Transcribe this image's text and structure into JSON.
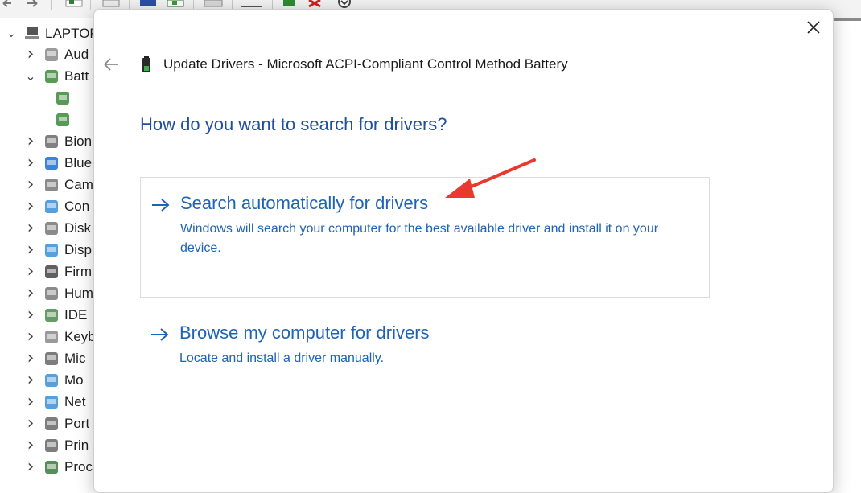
{
  "device_tree": {
    "root_label": "LAPTOP",
    "items": [
      {
        "label": "Aud",
        "icon": "speaker-icon",
        "expanded": false
      },
      {
        "label": "Batt",
        "icon": "battery-icon",
        "expanded": true
      },
      {
        "label": "",
        "icon": "battery-device-icon",
        "child": true
      },
      {
        "label": "",
        "icon": "battery-device-icon",
        "child": true
      },
      {
        "label": "Bion",
        "icon": "fingerprint-icon",
        "expanded": false
      },
      {
        "label": "Blue",
        "icon": "bluetooth-icon",
        "expanded": false
      },
      {
        "label": "Cam",
        "icon": "camera-icon",
        "expanded": false
      },
      {
        "label": "Con",
        "icon": "monitor-icon",
        "expanded": false
      },
      {
        "label": "Disk",
        "icon": "disk-drive-icon",
        "expanded": false
      },
      {
        "label": "Disp",
        "icon": "display-adapter-icon",
        "expanded": false
      },
      {
        "label": "Firm",
        "icon": "firmware-icon",
        "expanded": false
      },
      {
        "label": "Hum",
        "icon": "hid-icon",
        "expanded": false
      },
      {
        "label": "IDE",
        "icon": "ide-icon",
        "expanded": false
      },
      {
        "label": "Keyb",
        "icon": "keyboard-icon",
        "expanded": false
      },
      {
        "label": "Mic",
        "icon": "mouse-icon",
        "expanded": false
      },
      {
        "label": "Mo",
        "icon": "monitor-icon",
        "expanded": false
      },
      {
        "label": "Net",
        "icon": "network-icon",
        "expanded": false
      },
      {
        "label": "Port",
        "icon": "port-icon",
        "expanded": false
      },
      {
        "label": "Prin",
        "icon": "printer-icon",
        "expanded": false
      },
      {
        "label": "Proc",
        "icon": "processor-icon",
        "expanded": false
      }
    ]
  },
  "dialog": {
    "title": "Update Drivers - Microsoft ACPI-Compliant Control Method Battery",
    "heading": "How do you want to search for drivers?",
    "options": [
      {
        "title": "Search automatically for drivers",
        "description": "Windows will search your computer for the best available driver and install it on your device."
      },
      {
        "title": "Browse my computer for drivers",
        "description": "Locate and install a driver manually."
      }
    ]
  },
  "colors": {
    "link_blue": "#1e63b5",
    "heading_blue": "#1f4fa0",
    "annotation_red": "#e8392e"
  }
}
